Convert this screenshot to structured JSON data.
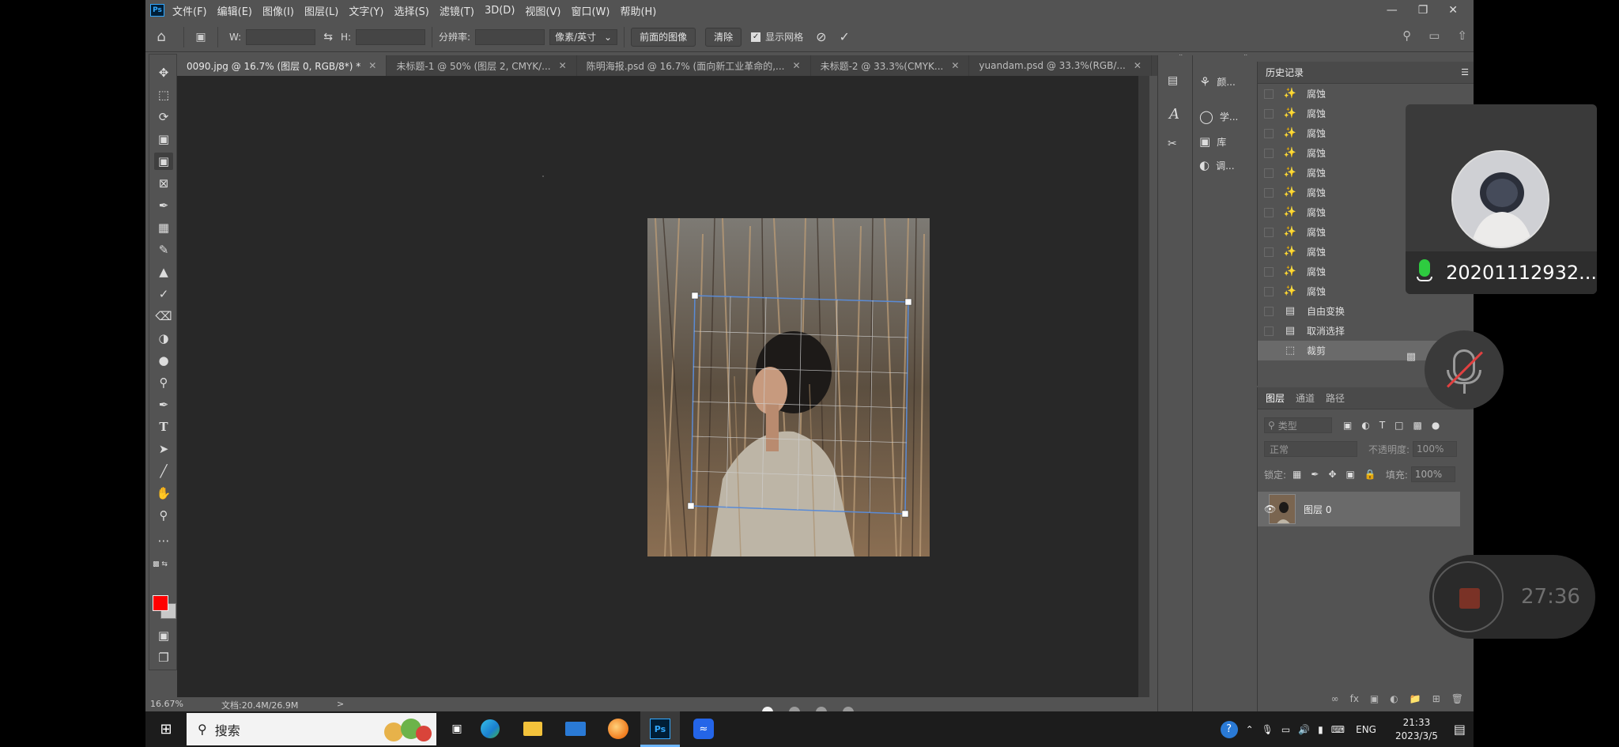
{
  "app": {
    "logo": "Ps",
    "menu": [
      "文件(F)",
      "编辑(E)",
      "图像(I)",
      "图层(L)",
      "文字(Y)",
      "选择(S)",
      "滤镜(T)",
      "3D(D)",
      "视图(V)",
      "窗口(W)",
      "帮助(H)"
    ]
  },
  "options": {
    "w_label": "W:",
    "h_label": "H:",
    "resolution_label": "分辨率:",
    "unit_select": "像素/英寸",
    "front_image_button": "前面的图像",
    "clear_button": "清除",
    "show_grid_label": "显示网格",
    "show_grid_checked": true
  },
  "tabs": [
    {
      "label": "0090.jpg @ 16.7% (图层 0, RGB/8*) *",
      "active": true
    },
    {
      "label": "未标题-1 @ 50% (图层 2, CMYK/...",
      "active": false
    },
    {
      "label": "陈明海报.psd @ 16.7% (面向新工业革命的,...",
      "active": false
    },
    {
      "label": "未标题-2 @ 33.3%(CMYK...",
      "active": false
    },
    {
      "label": "yuandam.psd @ 33.3%(RGB/...",
      "active": false
    }
  ],
  "status": {
    "zoom": "16.67%",
    "doc": "文档:20.4M/26.9M",
    "arrow": ">"
  },
  "side_icons": {
    "color": "颜...",
    "learn": "学...",
    "library": "库",
    "adjust": "调..."
  },
  "history": {
    "title": "历史记录",
    "items": [
      {
        "label": "腐蚀",
        "icon": "magic-wand"
      },
      {
        "label": "腐蚀",
        "icon": "magic-wand"
      },
      {
        "label": "腐蚀",
        "icon": "magic-wand"
      },
      {
        "label": "腐蚀",
        "icon": "magic-wand"
      },
      {
        "label": "腐蚀",
        "icon": "magic-wand"
      },
      {
        "label": "腐蚀",
        "icon": "magic-wand"
      },
      {
        "label": "腐蚀",
        "icon": "magic-wand"
      },
      {
        "label": "腐蚀",
        "icon": "magic-wand"
      },
      {
        "label": "腐蚀",
        "icon": "magic-wand"
      },
      {
        "label": "腐蚀",
        "icon": "magic-wand"
      },
      {
        "label": "腐蚀",
        "icon": "magic-wand"
      },
      {
        "label": "自由变换",
        "icon": "document"
      },
      {
        "label": "取消选择",
        "icon": "document"
      },
      {
        "label": "裁剪",
        "icon": "crop"
      }
    ]
  },
  "layers": {
    "tabs": [
      "图层",
      "通道",
      "路径"
    ],
    "filter_placeholder": "类型",
    "blend_mode": "正常",
    "opacity_label": "不透明度:",
    "opacity_value": "100%",
    "lock_label": "锁定:",
    "fill_label": "填充:",
    "fill_value": "100%",
    "layer_name": "图层 0"
  },
  "taskbar": {
    "search_label": "搜索",
    "lang": "ENG",
    "time": "21:33",
    "date": "2023/3/5"
  },
  "call": {
    "name": "20201112932...",
    "timer": "27:36"
  },
  "colors": {
    "foreground": "#ff0000",
    "background": "#c8c8c8",
    "accent": "#31a8ff",
    "mic_active": "#2ecc40"
  }
}
